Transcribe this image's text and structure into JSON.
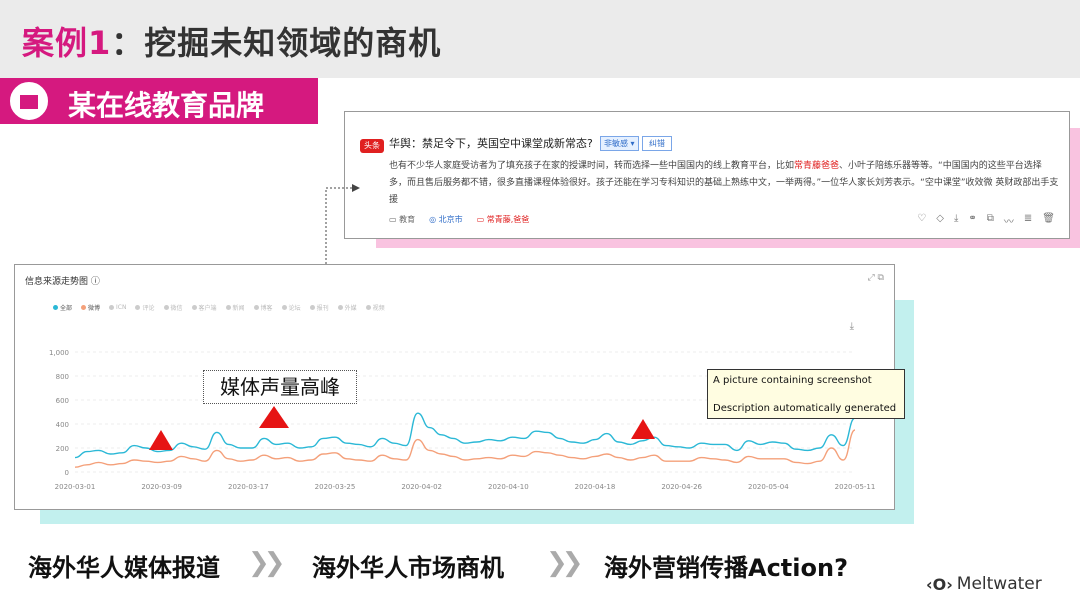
{
  "slide": {
    "title_case": "案例1",
    "title_rest": "：挖掘未知领域的商机",
    "brand": "某在线教育品牌"
  },
  "card": {
    "logo": "头条",
    "title": "华舆：禁足令下，英国空中课堂成新常态?",
    "tag": "非敏感 ▾",
    "tag2": "纠错",
    "body_1": "也有不少华人家庭受访者为了填充孩子在家的授课时间，转而选择一些中国国内的线上教育平台，比如",
    "body_hl1": "常青藤爸爸",
    "body_2": "、小叶子陪练乐器等等。“中国国内的这些平台选择多，而且售后服务都不错，很多直播课程体验很好。孩子还能在学习专科知识的基础上熟练中文，一举两得。”一位华人家长刘芳表示。“空中课堂”收效微 英财政部出手支援",
    "meta_cat": "教育",
    "meta_loc": "北京市",
    "meta_kw": "常青藤,爸爸",
    "actions": [
      "♡",
      "◇",
      "⤓",
      "⚭",
      "⧉",
      "〰",
      "≣",
      "🗑"
    ]
  },
  "chart": {
    "title": "信息来源走势图",
    "info_icon": "ⓘ",
    "tools": "⤢  ⧉",
    "download_icon": "⤓",
    "legend": [
      {
        "name": "全部",
        "color": "#2bb8d6"
      },
      {
        "name": "微博",
        "color": "#f4a07a"
      },
      {
        "name": "ICN",
        "color": "#cccccc"
      },
      {
        "name": "评论",
        "color": "#cccccc"
      },
      {
        "name": "微信",
        "color": "#cccccc"
      },
      {
        "name": "客户端",
        "color": "#cccccc"
      },
      {
        "name": "新闻",
        "color": "#cccccc"
      },
      {
        "name": "博客",
        "color": "#cccccc"
      },
      {
        "name": "论坛",
        "color": "#cccccc"
      },
      {
        "name": "报刊",
        "color": "#cccccc"
      },
      {
        "name": "外媒",
        "color": "#cccccc"
      },
      {
        "name": "视频",
        "color": "#cccccc"
      }
    ]
  },
  "chart_data": {
    "type": "line",
    "yticks": [
      "0",
      "200",
      "400",
      "600",
      "800",
      "1,000"
    ],
    "ylim": [
      0,
      1000
    ],
    "xticks": [
      "2020-03-01",
      "2020-03-09",
      "2020-03-17",
      "2020-03-25",
      "2020-04-02",
      "2020-04-10",
      "2020-04-18",
      "2020-04-26",
      "2020-05-04",
      "2020-05-11"
    ],
    "series": [
      {
        "name": "全部",
        "color": "#2bb8d6",
        "values": [
          120,
          170,
          180,
          150,
          160,
          220,
          200,
          170,
          180,
          240,
          210,
          190,
          330,
          230,
          200,
          200,
          280,
          230,
          240,
          200,
          210,
          280,
          290,
          240,
          230,
          210,
          280,
          240,
          220,
          490,
          370,
          310,
          280,
          240,
          250,
          270,
          260,
          290,
          280,
          340,
          330,
          280,
          250,
          240,
          270,
          320,
          250,
          230,
          260,
          290,
          220,
          210,
          200,
          240,
          230,
          230,
          180,
          260,
          230,
          250,
          240,
          190,
          180,
          200,
          310,
          220,
          450
        ]
      },
      {
        "name": "微博",
        "color": "#f4a07a",
        "values": [
          40,
          60,
          80,
          60,
          70,
          100,
          90,
          80,
          90,
          130,
          110,
          90,
          180,
          110,
          90,
          100,
          140,
          110,
          120,
          90,
          100,
          150,
          160,
          110,
          100,
          90,
          140,
          110,
          100,
          270,
          180,
          150,
          130,
          100,
          110,
          120,
          110,
          140,
          130,
          170,
          160,
          140,
          120,
          110,
          130,
          150,
          120,
          100,
          120,
          140,
          90,
          90,
          90,
          120,
          110,
          100,
          80,
          130,
          110,
          110,
          110,
          80,
          70,
          90,
          200,
          100,
          350
        ]
      }
    ]
  },
  "annotations": {
    "peak_label": "媒体声量高峰",
    "tooltip_line1": "A picture containing screenshot",
    "tooltip_line2": "Description automatically generated"
  },
  "footer": {
    "step1": "海外华人媒体报道",
    "step2": "海外华人市场商机",
    "step3": "海外营销传播Action?",
    "chevron": "❯❯",
    "brand": "Meltwater",
    "brand_icon": "‹O›"
  }
}
